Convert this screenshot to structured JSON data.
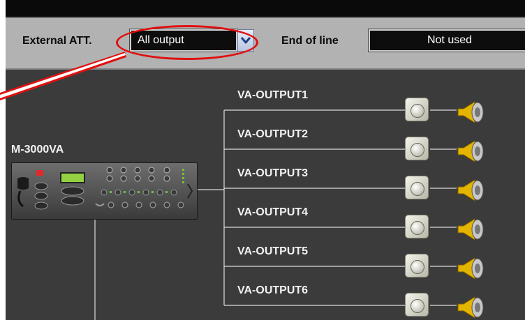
{
  "toolbar": {
    "external_att_label": "External ATT.",
    "external_att_value": "All output",
    "end_of_line_label": "End of line",
    "end_of_line_value": "Not used"
  },
  "device": {
    "label": "M-3000VA",
    "icon": "amplifier-device-icon"
  },
  "outputs": [
    {
      "label": "VA-OUTPUT1"
    },
    {
      "label": "VA-OUTPUT2"
    },
    {
      "label": "VA-OUTPUT3"
    },
    {
      "label": "VA-OUTPUT4"
    },
    {
      "label": "VA-OUTPUT5"
    },
    {
      "label": "VA-OUTPUT6"
    }
  ],
  "icons": {
    "attenuator": "volume-knob-icon",
    "speaker": "speaker-icon",
    "dropdown": "chevron-down-icon"
  },
  "colors": {
    "highlight": "#e01010",
    "canvas": "#3b3b3b",
    "toolbar": "#b2b2b2"
  }
}
